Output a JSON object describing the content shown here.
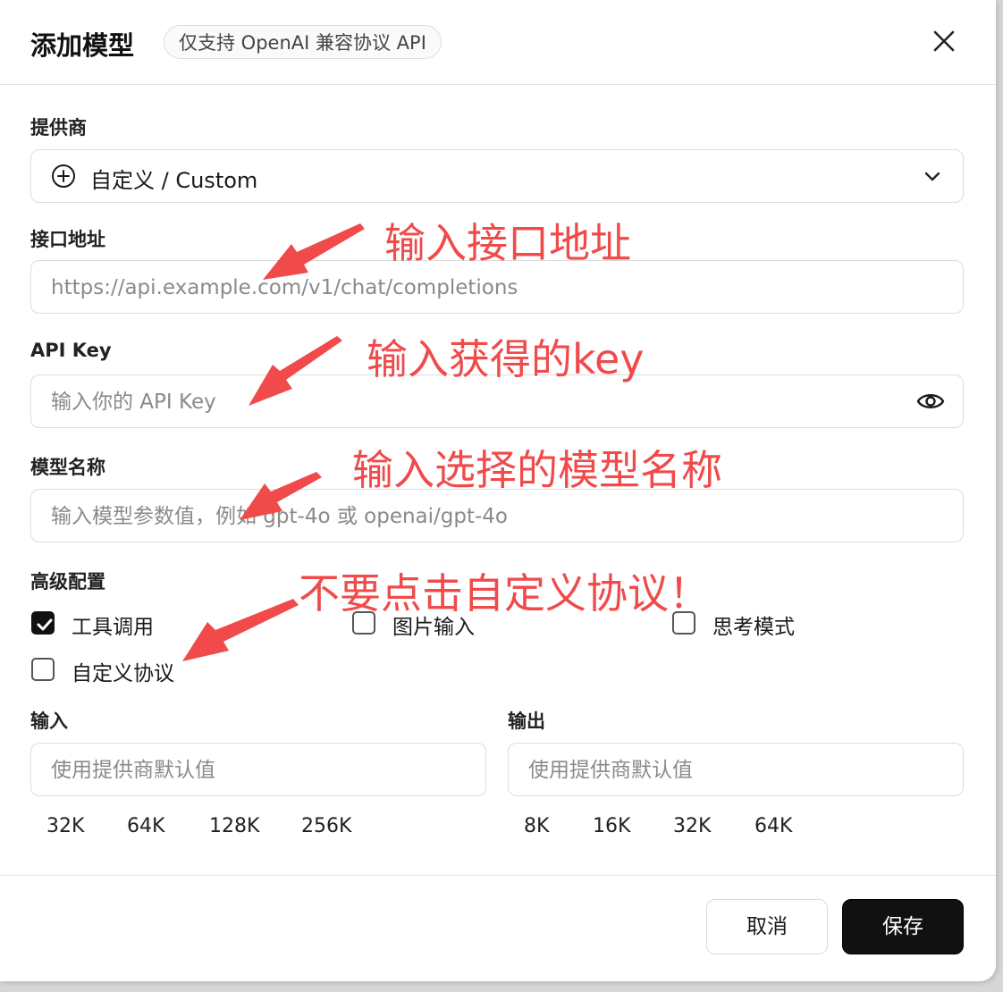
{
  "header": {
    "title": "添加模型",
    "badge": "仅支持 OpenAI 兼容协议 API"
  },
  "provider": {
    "label": "提供商",
    "value": "自定义 / Custom"
  },
  "endpoint": {
    "label": "接口地址",
    "placeholder": "https://api.example.com/v1/chat/completions"
  },
  "api_key": {
    "label": "API Key",
    "placeholder": "输入你的 API Key"
  },
  "model_name": {
    "label": "模型名称",
    "placeholder": "输入模型参数值，例如 gpt-4o 或 openai/gpt-4o"
  },
  "advanced": {
    "label": "高级配置",
    "options": [
      {
        "label": "工具调用",
        "checked": true
      },
      {
        "label": "图片输入",
        "checked": false
      },
      {
        "label": "思考模式",
        "checked": false
      },
      {
        "label": "自定义协议",
        "checked": false
      }
    ]
  },
  "input_tokens": {
    "label": "输入",
    "placeholder": "使用提供商默认值",
    "presets": [
      "32K",
      "64K",
      "128K",
      "256K"
    ]
  },
  "output_tokens": {
    "label": "输出",
    "placeholder": "使用提供商默认值",
    "presets": [
      "8K",
      "16K",
      "32K",
      "64K"
    ]
  },
  "footer": {
    "cancel_label": "取消",
    "save_label": "保存"
  },
  "annotations": {
    "endpoint_note": "输入接口地址",
    "key_note": "输入获得的key",
    "model_note": "输入选择的模型名称",
    "protocol_note": "不要点击自定义协议！"
  },
  "colors": {
    "annotation": "#f04a4a",
    "primary_button": "#111111"
  }
}
